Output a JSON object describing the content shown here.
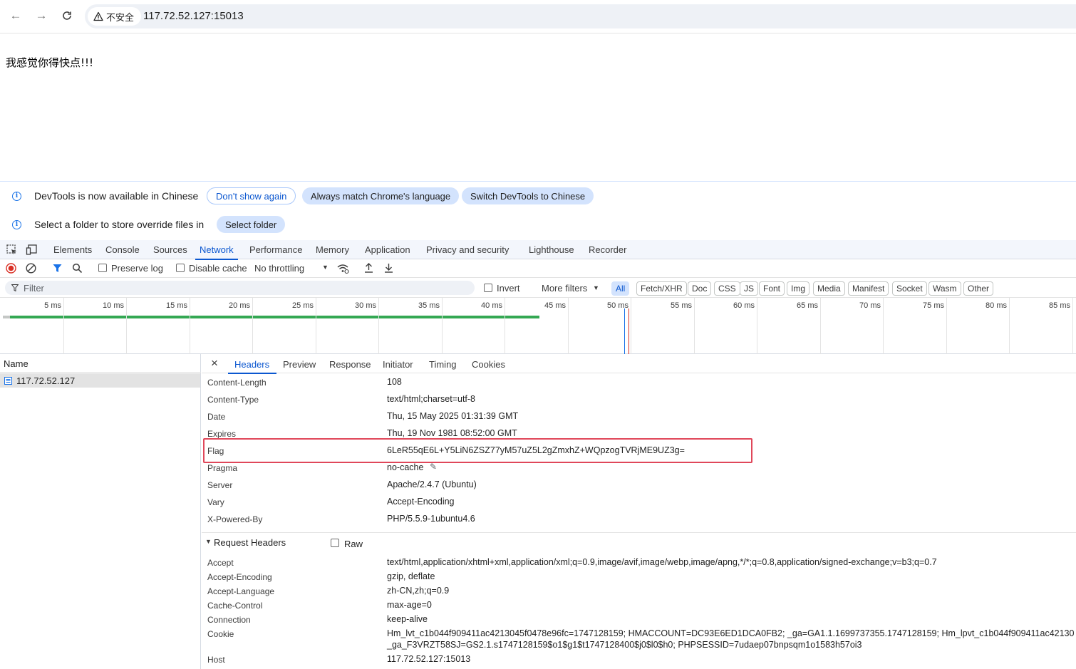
{
  "browser": {
    "security_label": "不安全",
    "url": "117.72.52.127:15013"
  },
  "page": {
    "message": "我感觉你得快点!!!"
  },
  "infobars": {
    "language": {
      "text": "DevTools is now available in Chinese",
      "dont_show": "Don't show again",
      "always_match": "Always match Chrome's language",
      "switch": "Switch DevTools to Chinese"
    },
    "overrides": {
      "text": "Select a folder to store override files in",
      "select_folder": "Select folder"
    }
  },
  "devtools_tabs": [
    "Elements",
    "Console",
    "Sources",
    "Network",
    "Performance",
    "Memory",
    "Application",
    "Privacy and security",
    "Lighthouse",
    "Recorder"
  ],
  "active_devtools_tab": "Network",
  "network_toolbar": {
    "preserve_log": "Preserve log",
    "disable_cache": "Disable cache",
    "throttling": "No throttling"
  },
  "filter": {
    "placeholder": "Filter",
    "invert": "Invert",
    "more_filters": "More filters",
    "types": [
      "All",
      "Fetch/XHR",
      "Doc",
      "CSS",
      "JS",
      "Font",
      "Img",
      "Media",
      "Manifest",
      "Socket",
      "Wasm",
      "Other"
    ],
    "active_type": "All"
  },
  "timeline": {
    "ticks": [
      "5 ms",
      "10 ms",
      "15 ms",
      "20 ms",
      "25 ms",
      "30 ms",
      "35 ms",
      "40 ms",
      "45 ms",
      "50 ms",
      "55 ms",
      "60 ms",
      "65 ms",
      "70 ms",
      "75 ms",
      "80 ms",
      "85 ms"
    ]
  },
  "requests": {
    "column": "Name",
    "items": [
      "117.72.52.127"
    ]
  },
  "detail_tabs": [
    "Headers",
    "Preview",
    "Response",
    "Initiator",
    "Timing",
    "Cookies"
  ],
  "active_detail_tab": "Headers",
  "response_headers": [
    {
      "key": "Content-Length",
      "value": "108"
    },
    {
      "key": "Content-Type",
      "value": "text/html;charset=utf-8"
    },
    {
      "key": "Date",
      "value": "Thu, 15 May 2025 01:31:39 GMT"
    },
    {
      "key": "Expires",
      "value": "Thu, 19 Nov 1981 08:52:00 GMT"
    },
    {
      "key": "Flag",
      "value": "6LeR55qE6L+Y5LiN6ZSZ77yM57uZ5L2gZmxhZ+WQpzogTVRjME9UZ3g="
    },
    {
      "key": "Pragma",
      "value": "no-cache"
    },
    {
      "key": "Server",
      "value": "Apache/2.4.7 (Ubuntu)"
    },
    {
      "key": "Vary",
      "value": "Accept-Encoding"
    },
    {
      "key": "X-Powered-By",
      "value": "PHP/5.5.9-1ubuntu4.6"
    }
  ],
  "request_headers_section": {
    "title": "Request Headers",
    "raw": "Raw"
  },
  "request_headers": [
    {
      "key": "Accept",
      "value": "text/html,application/xhtml+xml,application/xml;q=0.9,image/avif,image/webp,image/apng,*/*;q=0.8,application/signed-exchange;v=b3;q=0.7"
    },
    {
      "key": "Accept-Encoding",
      "value": "gzip, deflate"
    },
    {
      "key": "Accept-Language",
      "value": "zh-CN,zh;q=0.9"
    },
    {
      "key": "Cache-Control",
      "value": "max-age=0"
    },
    {
      "key": "Connection",
      "value": "keep-alive"
    },
    {
      "key": "Cookie",
      "value": "Hm_lvt_c1b044f909411ac4213045f0478e96fc=1747128159; HMACCOUNT=DC93E6ED1DCA0FB2; _ga=GA1.1.1699737355.1747128159; Hm_lpvt_c1b044f909411ac42130",
      "value2": "_ga_F3VRZT58SJ=GS2.1.s1747128159$o1$g1$t1747128400$j0$l0$h0; PHPSESSID=7udaep07bnpsqm1o1583h57oi3"
    },
    {
      "key": "Host",
      "value": "117.72.52.127:15013"
    }
  ],
  "colors": {
    "accent": "#0b57d0",
    "highlight_box": "#e0475a",
    "waterfall_bar": "#34a853"
  }
}
